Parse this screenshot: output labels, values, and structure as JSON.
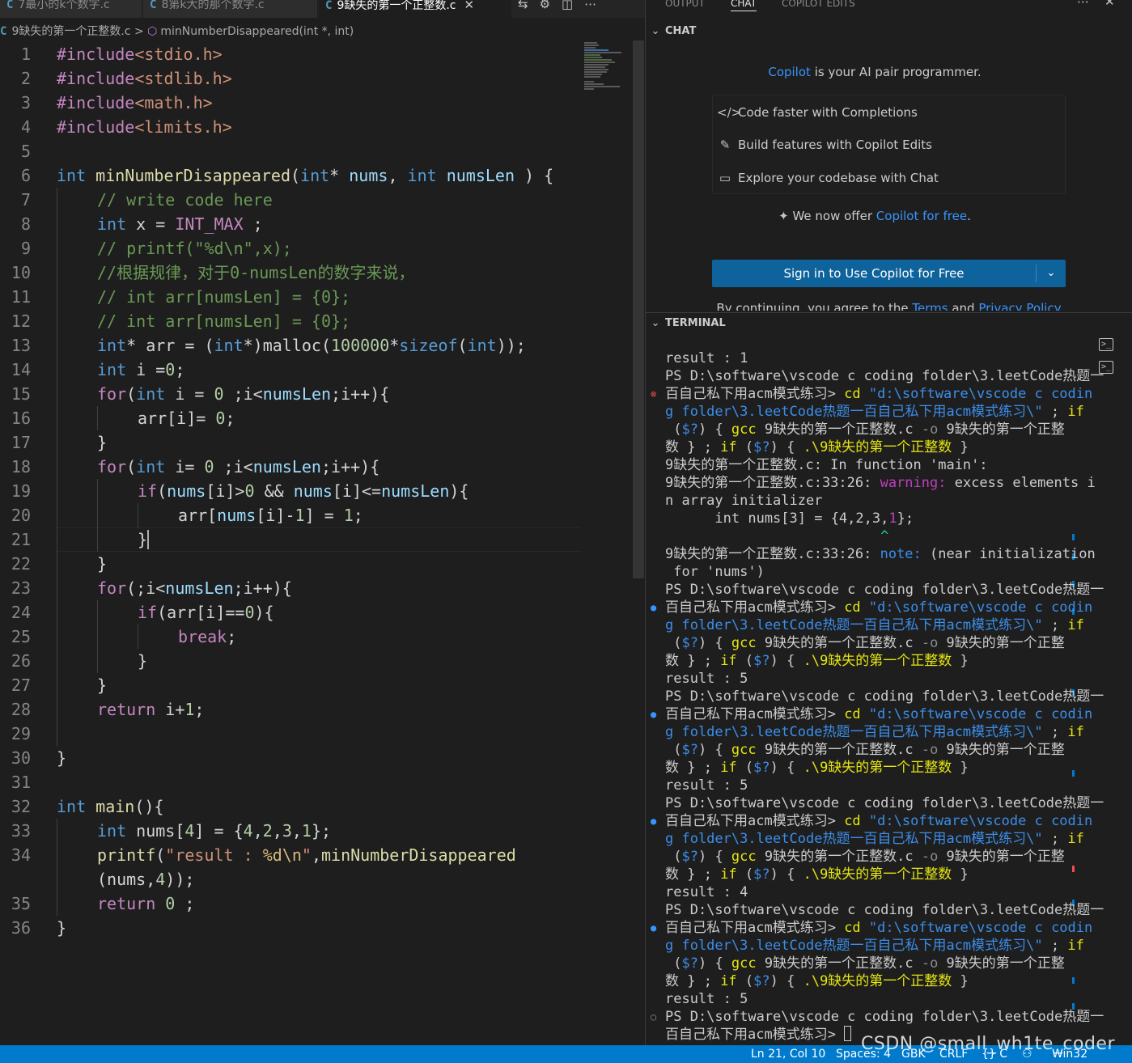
{
  "tabs": [
    {
      "name": "7最小的k个数字.c",
      "active": false
    },
    {
      "name": "8第k大的那个数字.c",
      "active": false
    },
    {
      "name": "9缺失的第一个正整数.c",
      "active": true
    }
  ],
  "tab_c_icon": "C",
  "tab_close_glyph": "✕",
  "editor_toolbar_icons": [
    "compare-icon",
    "settings-icon",
    "split-editor-icon",
    "more-icon"
  ],
  "breadcrumb": {
    "file": "9缺失的第一个正整数.c",
    "separator": ">",
    "symbol": "minNumberDisappeared(int *, int)"
  },
  "code_lines": [
    {
      "n": "1"
    },
    {
      "n": "2"
    },
    {
      "n": "3"
    },
    {
      "n": "4"
    },
    {
      "n": "5"
    },
    {
      "n": "6"
    },
    {
      "n": "7"
    },
    {
      "n": "8"
    },
    {
      "n": "9"
    },
    {
      "n": "10"
    },
    {
      "n": "11"
    },
    {
      "n": "12"
    },
    {
      "n": "13"
    },
    {
      "n": "14"
    },
    {
      "n": "15"
    },
    {
      "n": "16"
    },
    {
      "n": "17"
    },
    {
      "n": "18"
    },
    {
      "n": "19"
    },
    {
      "n": "20"
    },
    {
      "n": "21"
    },
    {
      "n": "22"
    },
    {
      "n": "23"
    },
    {
      "n": "24"
    },
    {
      "n": "25"
    },
    {
      "n": "26"
    },
    {
      "n": "27"
    },
    {
      "n": "28"
    },
    {
      "n": "29"
    },
    {
      "n": "30"
    },
    {
      "n": "31"
    },
    {
      "n": "32"
    },
    {
      "n": "33"
    },
    {
      "n": "34"
    },
    {
      "n": ""
    },
    {
      "n": "35"
    },
    {
      "n": "36"
    }
  ],
  "code_tokens": {
    "l1": [
      "#include",
      "<stdio.h>"
    ],
    "l2": [
      "#include",
      "<stdlib.h>"
    ],
    "l3": [
      "#include",
      "<math.h>"
    ],
    "l4": [
      "#include",
      "<limits.h>"
    ],
    "l6": [
      "int",
      " ",
      "minNumberDisappeared",
      "(",
      "int",
      "* ",
      "nums",
      ", ",
      "int",
      " ",
      "numsLen",
      " ) {"
    ],
    "l7": [
      "// write code here"
    ],
    "l8": [
      "int",
      " x = ",
      "INT_MAX",
      " ;"
    ],
    "l9": [
      "// printf(\"%d\\n\",x);"
    ],
    "l10": [
      "//根据规律，对于0-numsLen的数字来说，"
    ],
    "l11": [
      "// int arr[numsLen] = {0};"
    ],
    "l12": [
      "// int arr[numsLen] = {0};"
    ],
    "l13": [
      "int",
      "* arr = (",
      "int",
      "*)malloc(",
      "100000",
      "*",
      "sizeof",
      "(",
      "int",
      "));"
    ],
    "l14": [
      "int",
      " i =",
      "0",
      ";"
    ],
    "l15": [
      "for",
      "(",
      "int",
      " i = ",
      "0",
      " ;i<",
      "numsLen",
      ";i++){"
    ],
    "l16": [
      "arr[i]= ",
      "0",
      ";"
    ],
    "l17": [
      "}"
    ],
    "l18": [
      "for",
      "(",
      "int",
      " i= ",
      "0",
      " ;i<",
      "numsLen",
      ";i++){"
    ],
    "l19": [
      "if",
      "(",
      "nums",
      "[i]>",
      "0",
      " && ",
      "nums",
      "[i]<=",
      "numsLen",
      "){"
    ],
    "l20": [
      "arr[",
      "nums",
      "[i]-",
      "1",
      "] = ",
      "1",
      ";"
    ],
    "l21": [
      "}"
    ],
    "l22": [
      "}"
    ],
    "l23": [
      "for",
      "(;i<",
      "numsLen",
      ";i++){"
    ],
    "l24": [
      "if",
      "(arr[i]==",
      "0",
      "){"
    ],
    "l25": [
      "break",
      ";"
    ],
    "l26": [
      "}"
    ],
    "l27": [
      "}"
    ],
    "l28": [
      "return",
      " i+",
      "1",
      ";"
    ],
    "l30": [
      "}"
    ],
    "l32": [
      "int",
      " ",
      "main",
      "(){"
    ],
    "l33": [
      "int",
      " nums[",
      "4",
      "] = {",
      "4",
      ",",
      "2",
      ",",
      "3",
      ",",
      "1",
      "};"
    ],
    "l34": [
      "printf",
      "(",
      "\"result : ",
      "%d\\n",
      "\"",
      ",",
      "minNumberDisappeared"
    ],
    "l34b": [
      "(nums,",
      "4",
      "));"
    ],
    "l35": [
      "return",
      " ",
      "0",
      " ;"
    ],
    "l36": [
      "}"
    ]
  },
  "panel_tabs": [
    "OUTPUT",
    "CHAT",
    "COPILOT EDITS"
  ],
  "panel_active_tab": "CHAT",
  "panel_icons": [
    "more-icon",
    "close-icon"
  ],
  "chat": {
    "section_title": "CHAT",
    "intro_link": "Copilot",
    "intro_rest": " is your AI pair programmer.",
    "features": [
      {
        "icon": "code-icon",
        "glyph": "</>",
        "label": "Code faster with Completions"
      },
      {
        "icon": "edit-file-icon",
        "glyph": "✎",
        "label": "Build features with Copilot Edits"
      },
      {
        "icon": "chat-icon",
        "glyph": "▭",
        "label": "Explore your codebase with Chat"
      }
    ],
    "offer_prefix": "We now offer ",
    "offer_link": "Copilot for free",
    "offer_suffix": ".",
    "sign_in_label": "Sign in to Use Copilot for Free",
    "sign_in_dropdown": "⌄",
    "terms_prefix": "By continuing, you agree to the ",
    "terms_link1": "Terms",
    "terms_mid": " and ",
    "terms_link2": "Privacy Policy"
  },
  "terminal": {
    "section_title": "TERMINAL",
    "runs": [
      {
        "result": "result : 1"
      },
      {
        "result": "result : 5"
      },
      {
        "result": "result : 5"
      },
      {
        "result": "result : 4"
      },
      {
        "result": "result : 5"
      }
    ],
    "prompt1": "PS D:\\software\\vscode c coding folder\\3.leetCode热题一",
    "prompt2": "百自己私下用acm模式练习> ",
    "cmd_cd": "cd",
    "cmd_path1": " \"d:\\software\\vscode c codin",
    "cmd_path2": "g folder\\3.leetCode热题一百自己私下用acm模式练习\\\"",
    "cmd_semi": " ; ",
    "cmd_if": "if",
    "cmd_l3a": " (",
    "cmd_var": "$?",
    "cmd_l3b": ") { ",
    "cmd_gcc": "gcc",
    "cmd_src": " 9缺失的第一个正整数.c ",
    "cmd_o": "-o",
    "cmd_out": " 9缺失的第一个正整",
    "cmd_l4a": "数 } ; ",
    "cmd_l4b": " (",
    "cmd_l4c": ") { ",
    "cmd_exe": ".\\9缺失的第一个正整数",
    "cmd_l4d": " }",
    "err_in_fn": "9缺失的第一个正整数.c: In function 'main':",
    "err_loc": "9缺失的第一个正整数.c:33:26: ",
    "warn_label": "warning:",
    "warn_text1": " excess elements i",
    "warn_text2": "n array initializer",
    "err_code": "      int nums[3] = {4,2,3,",
    "err_code_hl": "1",
    "err_code_end": "};",
    "err_caret": "                          ^",
    "note_label": "note:",
    "note_text1": " (near initialization",
    "note_text2": " for 'nums')",
    "dots": [
      "err",
      "ok",
      "ok",
      "ok",
      "ok",
      "none"
    ],
    "dot_glyphs": {
      "err": "⊗",
      "ok": "●",
      "none": "○"
    },
    "side_icons": [
      "terminal-icon",
      "terminal-icon"
    ],
    "side_glyph": ">_"
  },
  "status_bar": {
    "position": "Ln 21, Col 10",
    "spaces": "Spaces: 4",
    "encoding": "GBK",
    "eol": "CRLF",
    "language": "{} C",
    "platform": "Win32"
  },
  "watermark": "CSDN @small_wh1te_coder",
  "colors": {
    "editor_bg": "#1e1e1e",
    "status_bar": "#007acc",
    "sign_in_button": "#0e639c",
    "link": "#3794ff"
  }
}
